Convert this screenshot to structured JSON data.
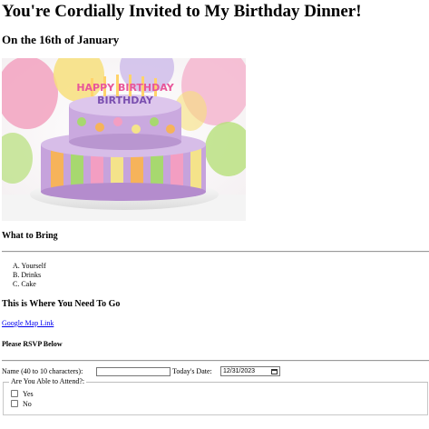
{
  "header": {
    "title": "You're Cordially Invited to My Birthday Dinner!",
    "subtitle": "On the 16th of January"
  },
  "image": {
    "alt": "Birthday cake",
    "cake_text": "HAPPY BIRTHDAY",
    "colors": {
      "balloon_pink": "#f2a2c0",
      "balloon_green": "#b7e07a",
      "balloon_yellow": "#f7df7c",
      "cake_purple": "#c6a3dc",
      "stripe_orange": "#f6b35a",
      "stripe_yellow": "#f4e38a",
      "stripe_green": "#a7d86f",
      "stripe_pink": "#f39ec2"
    }
  },
  "bring": {
    "heading": "What to Bring",
    "items": [
      "A. Yourself",
      "B. Drinks",
      "C. Cake"
    ]
  },
  "location": {
    "heading": "This is Where You Need To Go",
    "link_text": "Google Map Link"
  },
  "rsvp": {
    "heading": "Please RSVP Below",
    "name_label": "Name (40 to 10 characters):",
    "name_value": "",
    "date_label": "Today's Date:",
    "date_value": "12/31/2023",
    "attend_legend": "Are You Able to Attend?:",
    "options": [
      "Yes",
      "No"
    ]
  }
}
